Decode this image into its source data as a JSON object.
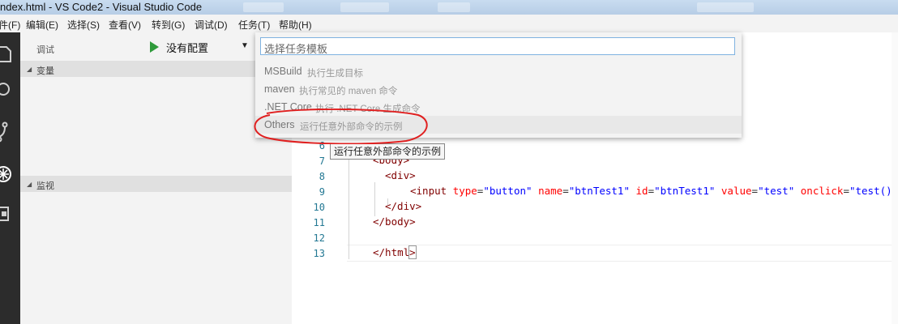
{
  "window": {
    "title": "ndex.html - VS Code2 - Visual Studio Code"
  },
  "menu": [
    {
      "label": "件(F)"
    },
    {
      "label": "编辑(E)"
    },
    {
      "label": "选择(S)"
    },
    {
      "label": "查看(V)"
    },
    {
      "label": "转到(G)"
    },
    {
      "label": "调试(D)"
    },
    {
      "label": "任务(T)"
    },
    {
      "label": "帮助(H)"
    }
  ],
  "activity_bar": {
    "icons": [
      "files-icon",
      "search-icon",
      "source-control-icon",
      "debug-icon",
      "extensions-icon"
    ]
  },
  "debug_toolbar": {
    "label": "调试",
    "config_value": "没有配置",
    "play_icon": "play-icon",
    "gear_icon": "gear-icon"
  },
  "sidebar": {
    "variables_title": "变量",
    "watch_title": "监视"
  },
  "task_picker": {
    "placeholder": "选择任务模板",
    "items": [
      {
        "name": "MSBuild",
        "desc": "执行生成目标"
      },
      {
        "name": "maven",
        "desc": "执行常见的 maven 命令"
      },
      {
        "name": ".NET Core",
        "desc": "执行 .NET Core 生成命令"
      },
      {
        "name": "Others",
        "desc": "运行任意外部命令的示例"
      }
    ]
  },
  "tooltip": {
    "text": "运行任意外部命令的示例"
  },
  "editor": {
    "line_numbers": [
      "6",
      "7",
      "8",
      "9",
      "10",
      "11",
      "12",
      "13"
    ],
    "lines": {
      "l7": "<body>",
      "l8": "<div>",
      "l9_input": "<input",
      "l9_type_attr": "type",
      "l9_type_val": "\"button\"",
      "l9_name_attr": "name",
      "l9_name_val": "\"btnTest1\"",
      "l9_id_attr": "id",
      "l9_id_val": "\"btnTest1\"",
      "l9_value_attr": "value",
      "l9_value_val": "\"test\"",
      "l9_onclick_attr": "onclick",
      "l9_onclick_val": "\"test()",
      "l10": "</div>",
      "l11": "</body>",
      "l13_open": "</html",
      "l13_close": ">"
    }
  },
  "colors": {
    "accent_border": "#7fb2e0",
    "annotation_ring": "#e02020",
    "activity_bar": "#2c2c2c"
  }
}
